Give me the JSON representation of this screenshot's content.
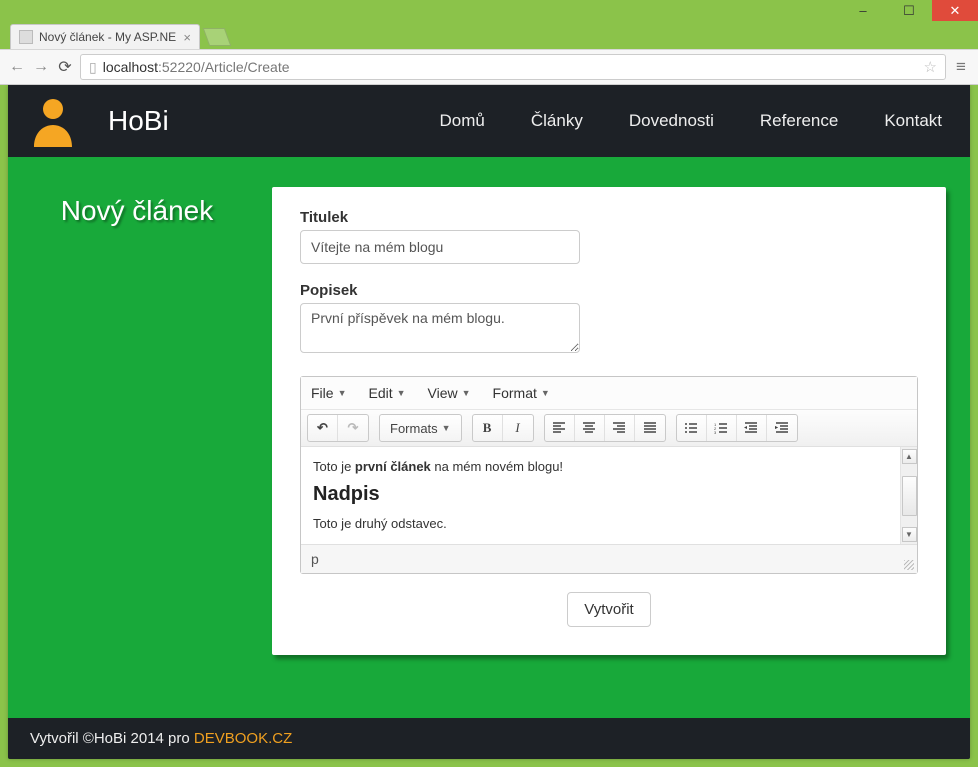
{
  "window": {
    "tab_title": "Nový článek - My ASP.NE",
    "url_host": "localhost",
    "url_port": ":52220",
    "url_path": "/Article/Create"
  },
  "nav": {
    "brand": "HoBi",
    "items": [
      "Domů",
      "Články",
      "Dovednosti",
      "Reference",
      "Kontakt"
    ]
  },
  "page": {
    "heading": "Nový článek",
    "form": {
      "title_label": "Titulek",
      "title_value": "Vítejte na mém blogu",
      "desc_label": "Popisek",
      "desc_value": "První příspěvek na mém blogu."
    },
    "editor": {
      "menu": [
        "File",
        "Edit",
        "View",
        "Format"
      ],
      "formats_label": "Formats",
      "body_para1_prefix": "Toto je ",
      "body_para1_bold": "první článek",
      "body_para1_suffix": " na mém novém blogu!",
      "body_heading": "Nadpis",
      "body_para2": "Toto je druhý odstavec.",
      "path": "p"
    },
    "submit_label": "Vytvořit"
  },
  "footer": {
    "text": "Vytvořil ©HoBi 2014 pro ",
    "link": "DEVBOOK.CZ"
  }
}
